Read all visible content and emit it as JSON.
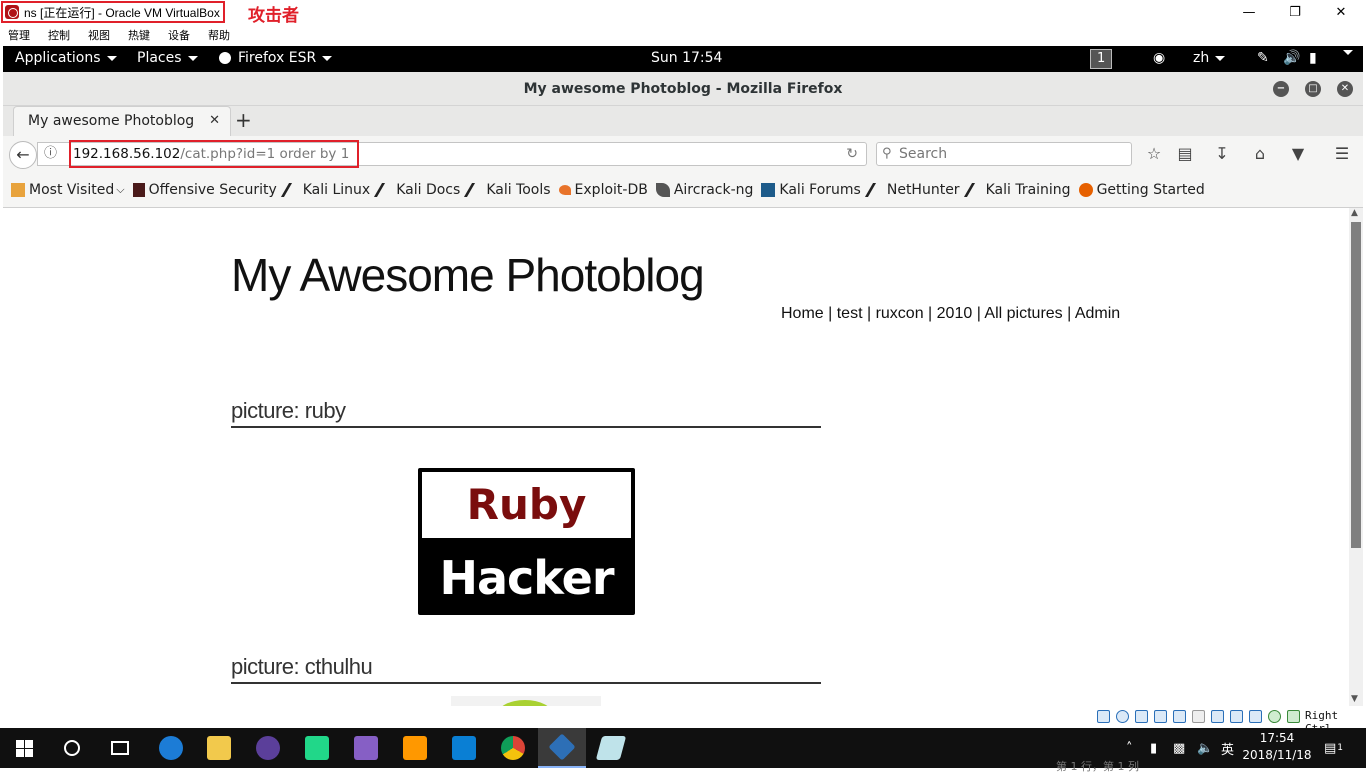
{
  "vbox": {
    "window_title": "ns [正在运行] - Oracle VM VirtualBox",
    "annotation": "攻击者",
    "controls": {
      "minimize": "—",
      "restore": "❐",
      "close": "✕"
    },
    "menu": [
      "管理",
      "控制",
      "视图",
      "热键",
      "设备",
      "帮助"
    ],
    "host_key": "Right Ctrl"
  },
  "gnome": {
    "applications": "Applications",
    "places": "Places",
    "firefox": "Firefox ESR",
    "clock": "Sun 17:54",
    "workspace": "1",
    "lang": "zh"
  },
  "firefox": {
    "window_title": "My awesome Photoblog - Mozilla Firefox",
    "tab_title": "My awesome Photoblog",
    "url_host": "192.168.56.102",
    "url_path": "/cat.php?id=1 order by 1",
    "search_placeholder": "Search",
    "bookmarks": [
      "Most Visited",
      "Offensive Security",
      "Kali Linux",
      "Kali Docs",
      "Kali Tools",
      "Exploit-DB",
      "Aircrack-ng",
      "Kali Forums",
      "NetHunter",
      "Kali Training",
      "Getting Started"
    ]
  },
  "page": {
    "title": "My Awesome Photoblog",
    "nav": [
      "Home",
      "test",
      "ruxcon",
      "2010",
      "All pictures",
      "Admin"
    ],
    "pictures": [
      {
        "heading": "picture: ruby",
        "image_top": "Ruby",
        "image_bottom": "Hacker"
      },
      {
        "heading": "picture: cthulhu"
      }
    ]
  },
  "taskbar": {
    "time": "17:54",
    "date": "2018/11/18",
    "ime": "英",
    "notification_count": "1",
    "status_text": "第 1 行，第 1 列"
  },
  "colors": {
    "annotation_red": "#e0202a",
    "gnome_bar": "#000000",
    "taskbar": "#101010",
    "ruby_red": "#7a0d0d"
  }
}
